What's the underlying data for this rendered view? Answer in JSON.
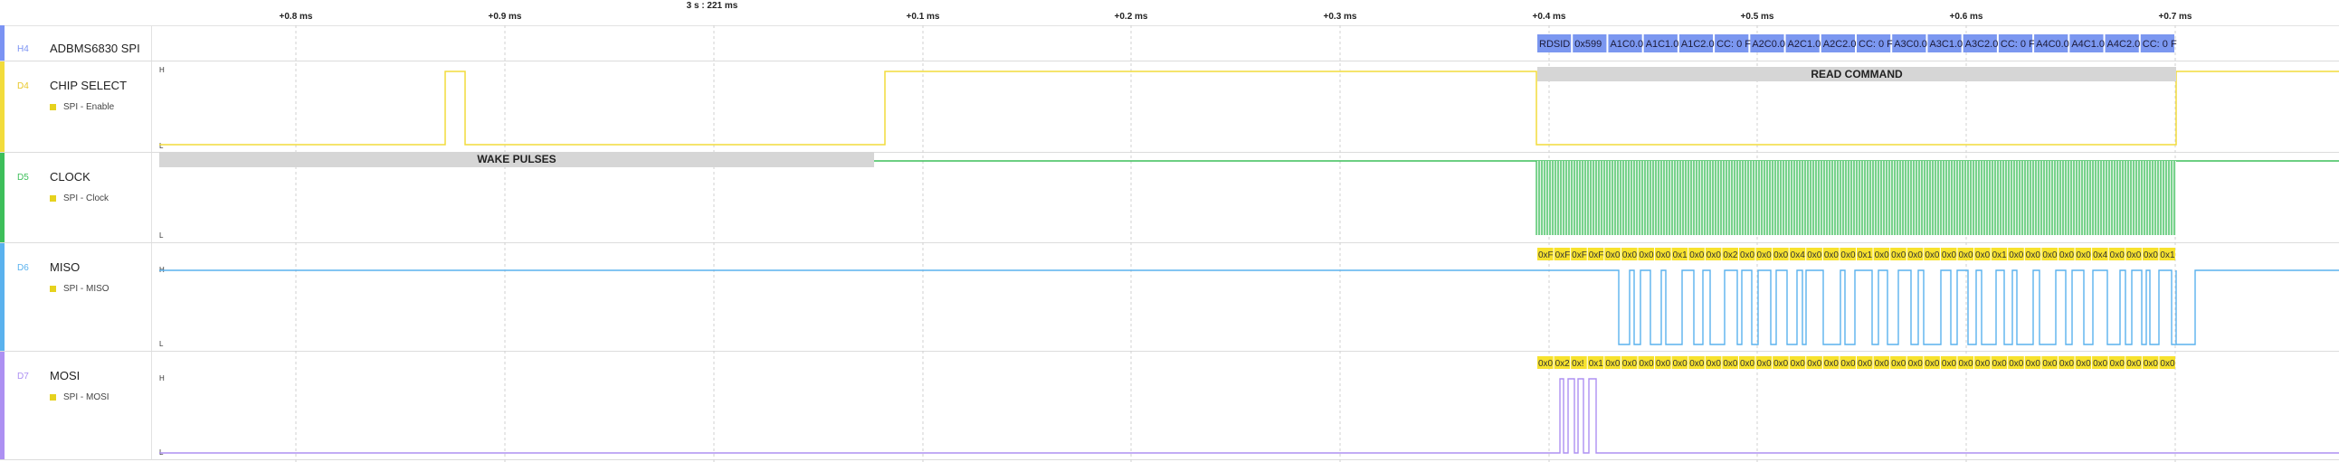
{
  "timeline": {
    "cursor_label": "3 s : 221 ms",
    "ticks": [
      "+0.8 ms",
      "+0.9 ms",
      "+0.1 ms",
      "+0.2 ms",
      "+0.3 ms",
      "+0.4 ms",
      "+0.5 ms",
      "+0.6 ms",
      "+0.7 ms"
    ]
  },
  "channels": [
    {
      "id": "H4",
      "name": "ADBMS6830 SPI",
      "color": "#7b93f3",
      "sub": ""
    },
    {
      "id": "D4",
      "name": "CHIP SELECT",
      "color": "#f2dc3b",
      "sub": "SPI - Enable"
    },
    {
      "id": "D5",
      "name": "CLOCK",
      "color": "#3dbf5a",
      "sub": "SPI - Clock"
    },
    {
      "id": "D6",
      "name": "MISO",
      "color": "#5ab2ee",
      "sub": "SPI - MISO"
    },
    {
      "id": "D7",
      "name": "MOSI",
      "color": "#ad90f2",
      "sub": "SPI - MOSI"
    }
  ],
  "level_labels": {
    "high": "H",
    "low": "L"
  },
  "annotations": {
    "read_command": "READ COMMAND",
    "wake_pulses": "WAKE PULSES"
  },
  "spi_frames": [
    "RDSID",
    "0x599",
    "A1C0.0",
    "A1C1.0",
    "A1C2.0",
    "CC: 0 F",
    "A2C0.0",
    "A2C1.0",
    "A2C2.0",
    "CC: 0 F",
    "A3C0.0",
    "A3C1.0",
    "A3C2.0",
    "CC: 0 F",
    "A4C0.0",
    "A4C1.0",
    "A4C2.0",
    "CC: 0 F"
  ],
  "miso_bytes": [
    "0xF",
    "0xF",
    "0xF",
    "0xF",
    "0x0",
    "0x0",
    "0x0",
    "0x0",
    "0x1",
    "0x0",
    "0x0",
    "0x2",
    "0x0",
    "0x0",
    "0x0",
    "0x4",
    "0x0",
    "0x0",
    "0x0",
    "0x1",
    "0x0",
    "0x0",
    "0x0",
    "0x0",
    "0x0",
    "0x0",
    "0x0",
    "0x1",
    "0x0",
    "0x0",
    "0x0",
    "0x0",
    "0x0",
    "0x4",
    "0x0",
    "0x0",
    "0x0",
    "0x1"
  ],
  "mosi_bytes": [
    "0x0",
    "0x2",
    "0x!",
    "0x1",
    "0x0",
    "0x0",
    "0x0",
    "0x0",
    "0x0",
    "0x0",
    "0x0",
    "0x0",
    "0x0",
    "0x0",
    "0x0",
    "0x0",
    "0x0",
    "0x0",
    "0x0",
    "0x0",
    "0x0",
    "0x0",
    "0x0",
    "0x0",
    "0x0",
    "0x0",
    "0x0",
    "0x0",
    "0x0",
    "0x0",
    "0x0",
    "0x0",
    "0x0",
    "0x0",
    "0x0",
    "0x0",
    "0x0",
    "0x0"
  ],
  "colors": {
    "frame_bg": "#7b97f0",
    "byte_bg": "#f7e22d",
    "annotation_bg": "#d6d6d6"
  }
}
